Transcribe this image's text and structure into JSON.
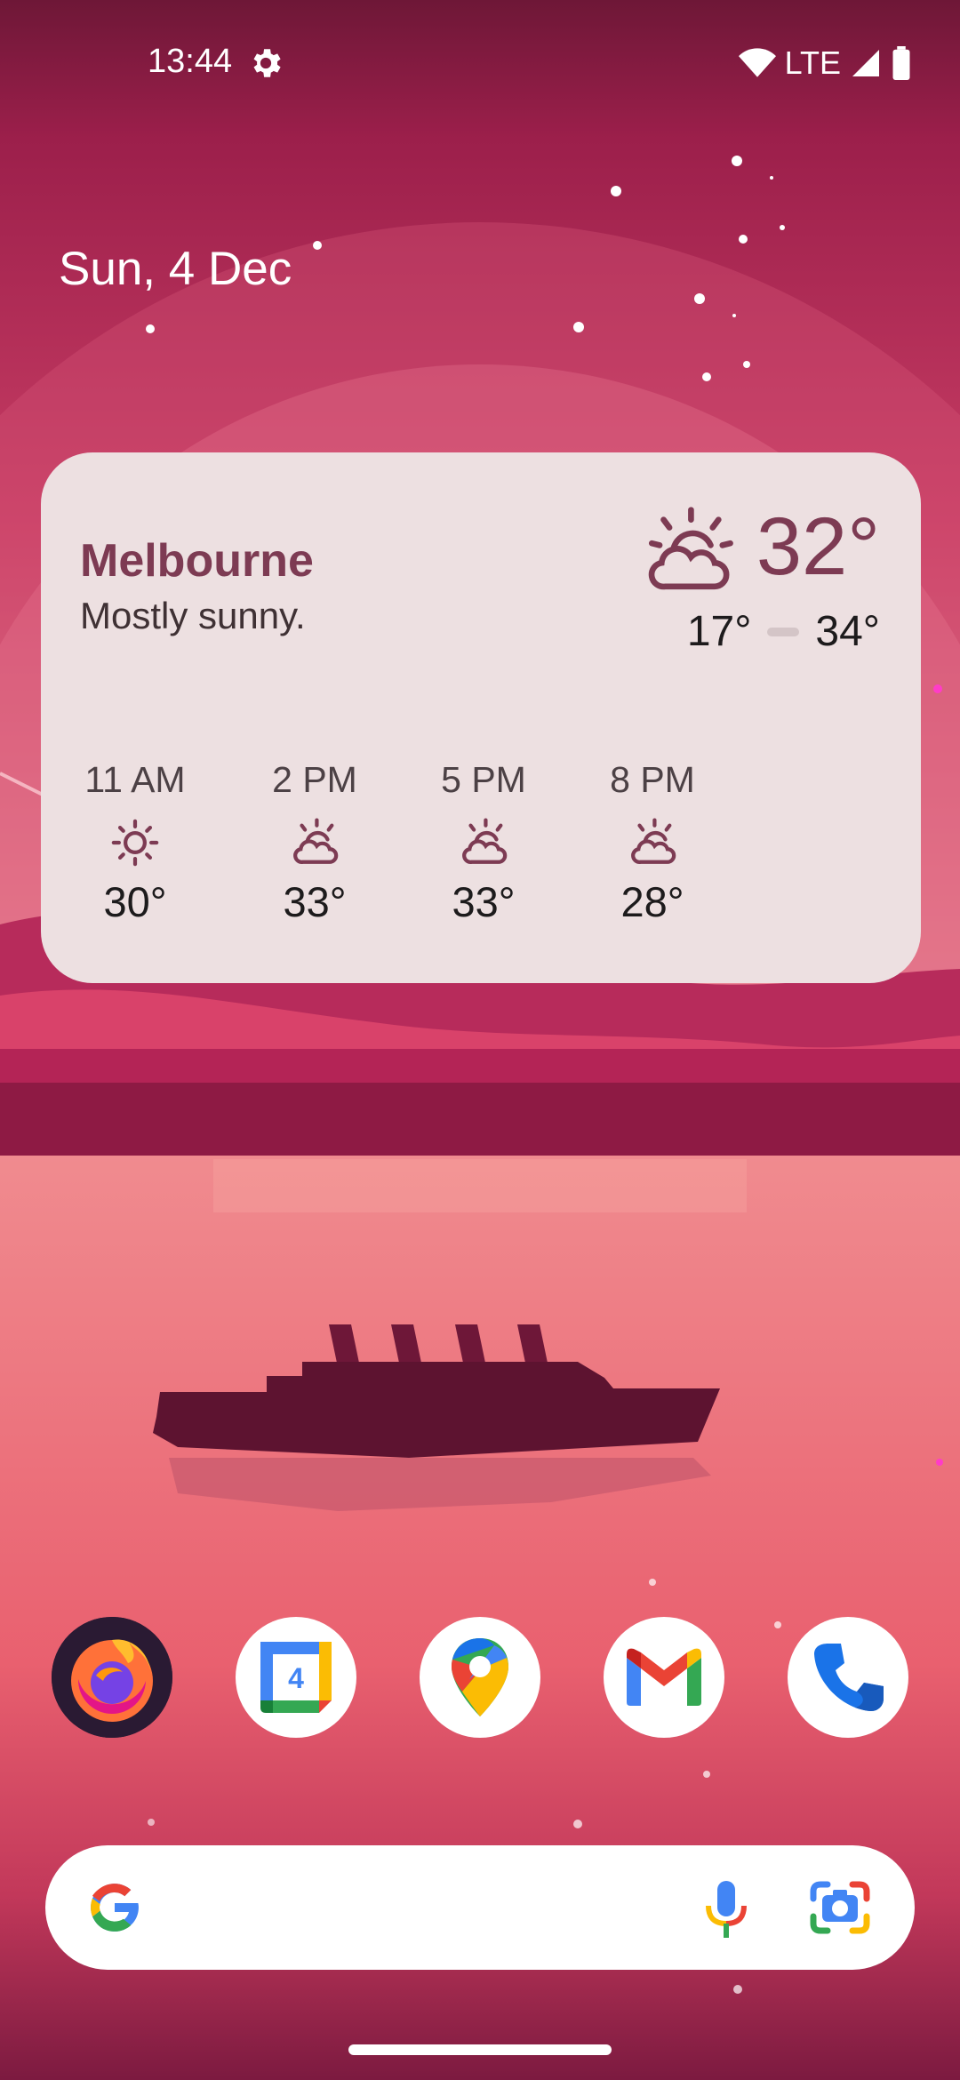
{
  "status_bar": {
    "time": "13:44",
    "network": "LTE",
    "icons": [
      "settings-gear-icon",
      "wifi-icon",
      "cell-signal-icon",
      "battery-icon"
    ]
  },
  "date_widget": {
    "text": "Sun, 4 Dec"
  },
  "weather_widget": {
    "city": "Melbourne",
    "condition": "Mostly sunny.",
    "current_temp": "32°",
    "low": "17°",
    "high": "34°",
    "current_icon": "partly-sunny-icon",
    "hourly": [
      {
        "time": "11 AM",
        "temp": "30°",
        "icon": "sun-icon"
      },
      {
        "time": "2 PM",
        "temp": "33°",
        "icon": "partly-sunny-icon"
      },
      {
        "time": "5 PM",
        "temp": "33°",
        "icon": "partly-sunny-icon"
      },
      {
        "time": "8 PM",
        "temp": "28°",
        "icon": "partly-sunny-icon"
      }
    ]
  },
  "dock": {
    "apps": [
      {
        "name": "Firefox",
        "icon": "firefox-icon"
      },
      {
        "name": "Calendar",
        "icon": "calendar-icon",
        "day": "4"
      },
      {
        "name": "Maps",
        "icon": "maps-icon"
      },
      {
        "name": "Gmail",
        "icon": "gmail-icon"
      },
      {
        "name": "Phone",
        "icon": "phone-icon"
      }
    ]
  },
  "search_bar": {
    "icons": [
      "google-g-icon",
      "microphone-icon",
      "google-lens-icon"
    ]
  },
  "colors": {
    "accent": "#7d3b53",
    "card_bg": "#ede0e1",
    "wallpaper_top": "#9a1f4a",
    "wallpaper_water": "#f07f86"
  }
}
